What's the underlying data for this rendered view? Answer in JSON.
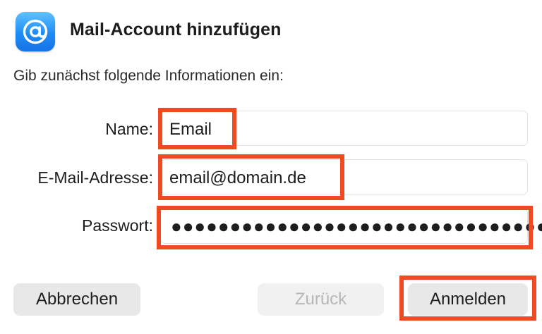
{
  "dialog": {
    "title": "Mail-Account hinzufügen",
    "icon": "mail-at-icon",
    "intro": "Gib zunächst folgende Informationen ein:"
  },
  "form": {
    "name_label": "Name:",
    "name_value": "Email",
    "email_label": "E-Mail-Adresse:",
    "email_value": "email@domain.de",
    "password_label": "Passwort:",
    "password_value": "●●●●●●●●●●●●●●●●●●●●●●●●●●●●●●●●"
  },
  "buttons": {
    "cancel": "Abbrechen",
    "back": "Zurück",
    "sign_in": "Anmelden"
  },
  "colors": {
    "highlight": "#f04a23",
    "icon_blue": "#1e8cf5"
  }
}
